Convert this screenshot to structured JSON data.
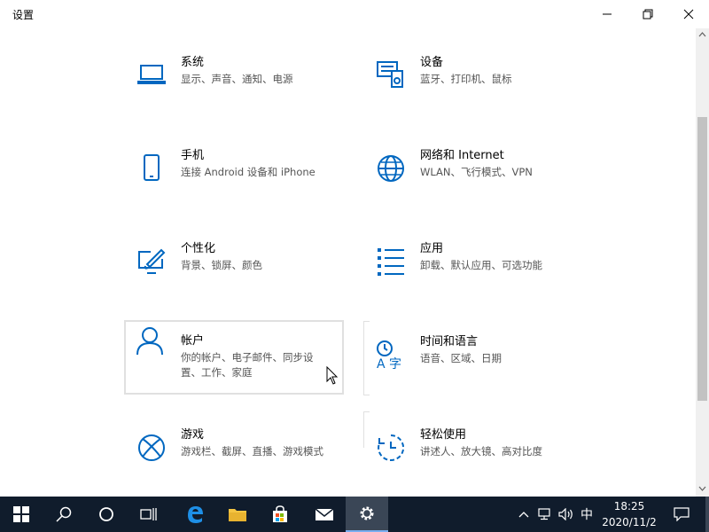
{
  "window": {
    "title": "设置"
  },
  "tiles": [
    {
      "name": "系统",
      "desc": "显示、声音、通知、电源",
      "icon": "laptop-icon"
    },
    {
      "name": "设备",
      "desc": "蓝牙、打印机、鼠标",
      "icon": "devices-icon"
    },
    {
      "name": "手机",
      "desc": "连接 Android 设备和 iPhone",
      "icon": "phone-icon"
    },
    {
      "name": "网络和 Internet",
      "desc": "WLAN、飞行模式、VPN",
      "icon": "globe-icon"
    },
    {
      "name": "个性化",
      "desc": "背景、锁屏、颜色",
      "icon": "personalization-icon"
    },
    {
      "name": "应用",
      "desc": "卸载、默认应用、可选功能",
      "icon": "apps-list-icon"
    },
    {
      "name": "帐户",
      "desc": "你的帐户、电子邮件、同步设置、工作、家庭",
      "icon": "person-icon"
    },
    {
      "name": "时间和语言",
      "desc": "语音、区域、日期",
      "icon": "time-language-icon"
    },
    {
      "name": "游戏",
      "desc": "游戏栏、截屏、直播、游戏模式",
      "icon": "xbox-icon"
    },
    {
      "name": "轻松使用",
      "desc": "讲述人、放大镜、高对比度",
      "icon": "ease-of-access-icon"
    }
  ],
  "taskbar": {
    "ime": "中",
    "time": "18:25",
    "date": "2020/11/2"
  },
  "colors": {
    "accent": "#0067c0",
    "taskbar": "#101c2c"
  }
}
